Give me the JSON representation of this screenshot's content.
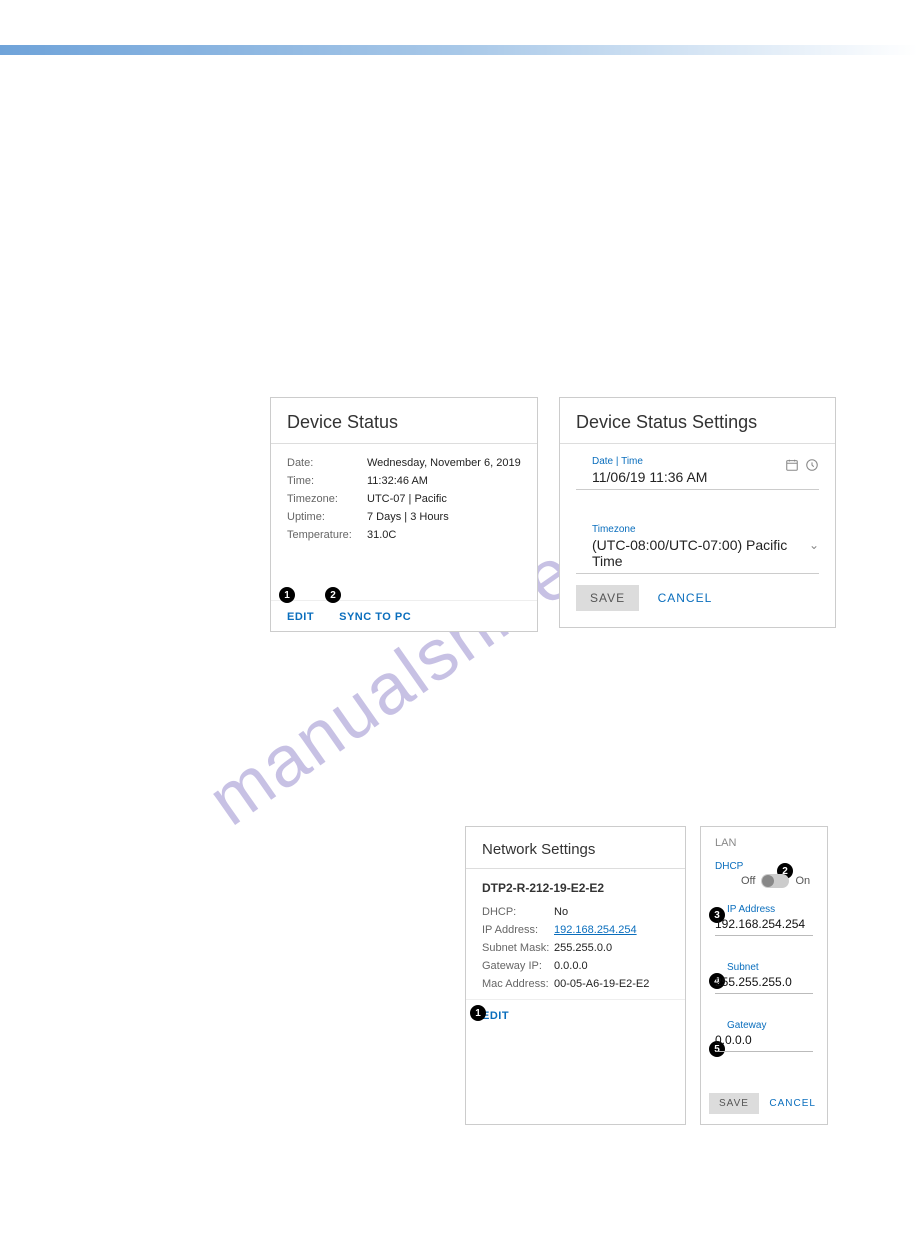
{
  "watermark": "manualshive.com",
  "device_status": {
    "title": "Device Status",
    "rows": {
      "date_label": "Date:",
      "date_value": "Wednesday, November 6, 2019",
      "time_label": "Time:",
      "time_value": "11:32:46 AM",
      "tz_label": "Timezone:",
      "tz_value": "UTC-07 | Pacific",
      "uptime_label": "Uptime:",
      "uptime_value": "7 Days | 3 Hours",
      "temp_label": "Temperature:",
      "temp_value": "31.0C"
    },
    "edit_label": "EDIT",
    "sync_label": "SYNC TO PC"
  },
  "device_status_settings": {
    "title": "Device Status Settings",
    "datetime_label": "Date | Time",
    "datetime_value": "11/06/19 11:36 AM",
    "timezone_label": "Timezone",
    "timezone_value": "(UTC-08:00/UTC-07:00) Pacific Time",
    "save_label": "SAVE",
    "cancel_label": "CANCEL"
  },
  "network_settings": {
    "title": "Network Settings",
    "device_name": "DTP2-R-212-19-E2-E2",
    "rows": {
      "dhcp_label": "DHCP:",
      "dhcp_value": "No",
      "ip_label": "IP Address:",
      "ip_value": "192.168.254.254",
      "subnet_label": "Subnet Mask:",
      "subnet_value": "255.255.0.0",
      "gateway_label": "Gateway IP:",
      "gateway_value": "0.0.0.0",
      "mac_label": "Mac Address:",
      "mac_value": "00-05-A6-19-E2-E2"
    },
    "edit_label": "EDIT"
  },
  "lan": {
    "title": "LAN",
    "dhcp_label": "DHCP",
    "off_label": "Off",
    "on_label": "On",
    "ip_label": "IP Address",
    "ip_value": "192.168.254.254",
    "subnet_label": "Subnet",
    "subnet_value": "255.255.255.0",
    "gateway_label": "Gateway",
    "gateway_value": "0.0.0.0",
    "save_label": "SAVE",
    "cancel_label": "CANCEL"
  },
  "callouts": {
    "c1": "1",
    "c2": "2",
    "c3": "3",
    "c4": "4",
    "c5": "5"
  }
}
